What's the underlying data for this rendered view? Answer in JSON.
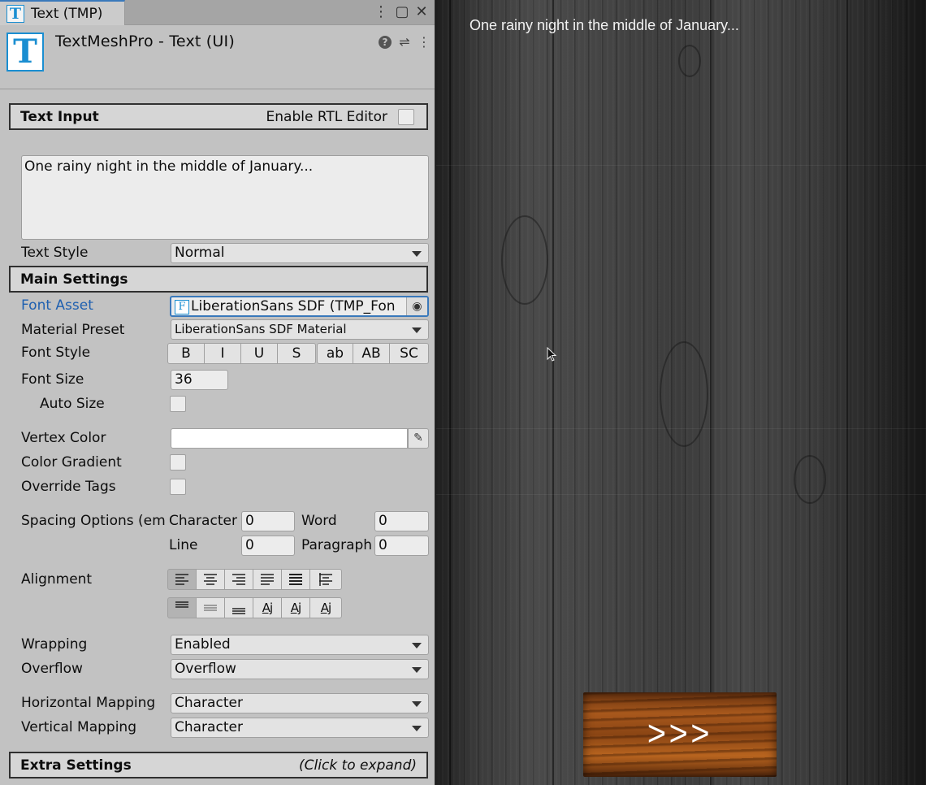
{
  "tab": {
    "label": "Text (TMP)",
    "icon": "tmp-text-icon"
  },
  "component": {
    "title": "TextMeshPro - Text (UI)",
    "help_icon": "help-icon",
    "presets_icon": "sliders-icon",
    "menu_icon": "kebab-menu-icon"
  },
  "sections": {
    "text_input": {
      "title": "Text Input",
      "rtl_label": "Enable RTL Editor",
      "rtl_checked": false
    },
    "main_settings": {
      "title": "Main Settings"
    },
    "extra_settings": {
      "title": "Extra Settings",
      "hint": "(Click to expand)"
    }
  },
  "text_input_value": "One rainy night in the middle of January...",
  "text_style": {
    "label": "Text Style",
    "value": "Normal"
  },
  "font_asset": {
    "label": "Font Asset",
    "value": "LiberationSans SDF (TMP_Fon",
    "icon_letter": "F"
  },
  "material_preset": {
    "label": "Material Preset",
    "value": "LiberationSans SDF Material"
  },
  "font_style": {
    "label": "Font Style",
    "buttons": [
      "B",
      "I",
      "U",
      "S",
      "ab",
      "AB",
      "SC"
    ]
  },
  "font_size": {
    "label": "Font Size",
    "value": "36"
  },
  "auto_size": {
    "label": "Auto Size",
    "checked": false
  },
  "vertex_color": {
    "label": "Vertex Color",
    "value": "#FFFFFF"
  },
  "color_gradient": {
    "label": "Color Gradient",
    "checked": false
  },
  "override_tags": {
    "label": "Override Tags",
    "checked": false
  },
  "spacing": {
    "label": "Spacing Options (em",
    "character_label": "Character",
    "character_value": "0",
    "word_label": "Word",
    "word_value": "0",
    "line_label": "Line",
    "line_value": "0",
    "paragraph_label": "Paragraph",
    "paragraph_value": "0"
  },
  "alignment": {
    "label": "Alignment",
    "vertical_glyph": "Aj"
  },
  "wrapping": {
    "label": "Wrapping",
    "value": "Enabled"
  },
  "overflow": {
    "label": "Overflow",
    "value": "Overflow"
  },
  "horizontal_mapping": {
    "label": "Horizontal Mapping",
    "value": "Character"
  },
  "vertical_mapping": {
    "label": "Vertical Mapping",
    "value": "Character"
  },
  "game_view": {
    "text": "One rainy night in the middle of January...",
    "next_button_label": ">>>"
  },
  "colors": {
    "accent": "#3a79bb",
    "link_blue": "#1f60b0",
    "panel_bg": "#c2c2c2"
  }
}
